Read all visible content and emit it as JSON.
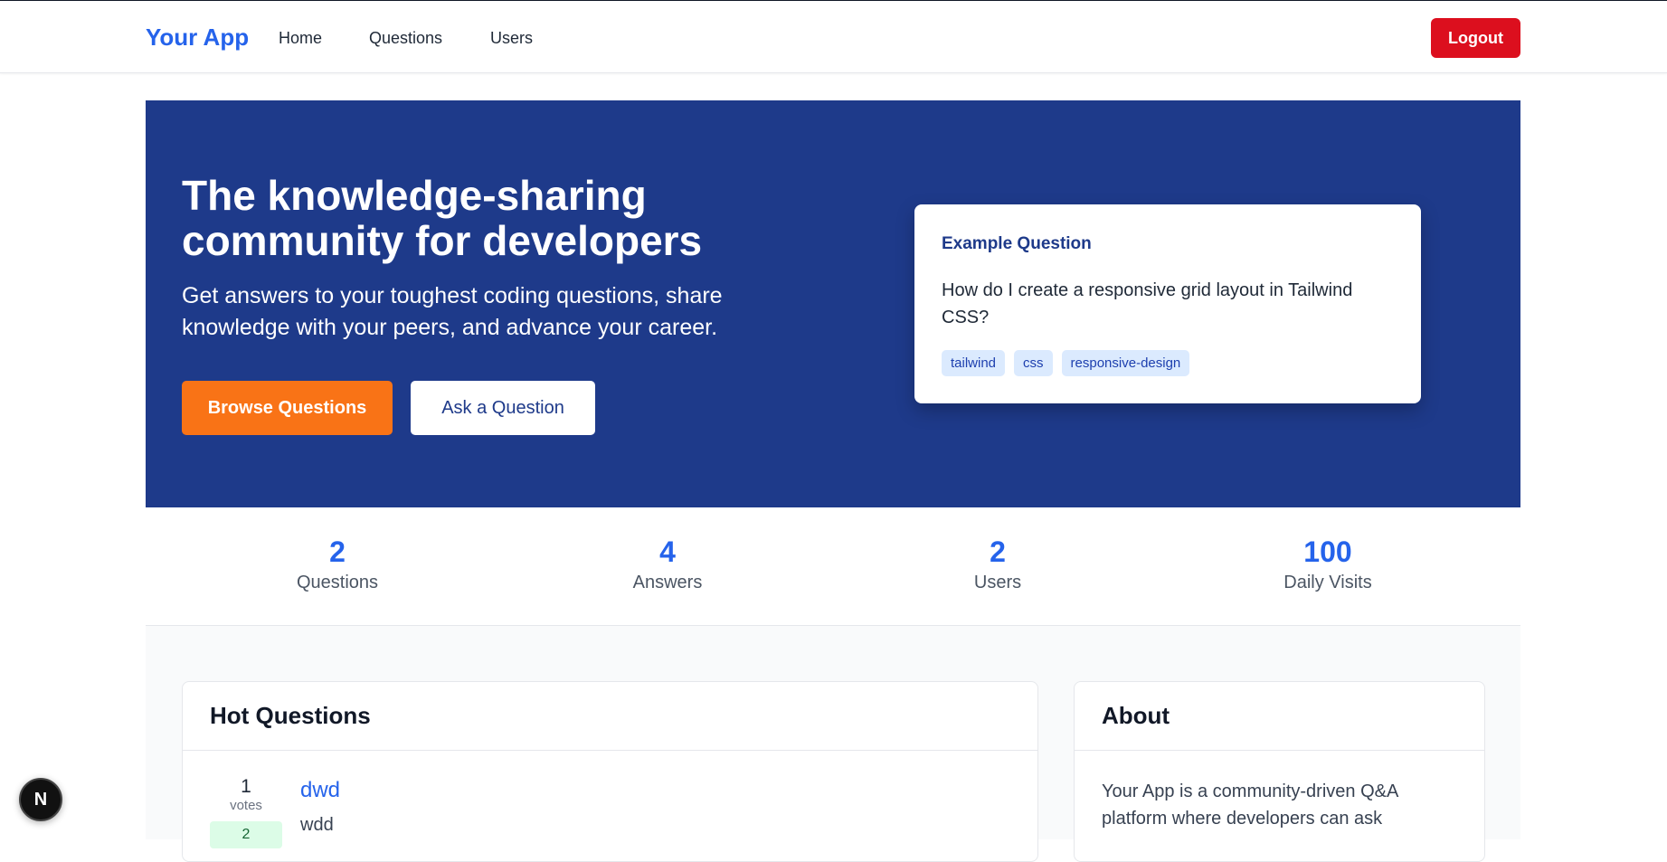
{
  "navbar": {
    "brand": "Your App",
    "links": [
      "Home",
      "Questions",
      "Users"
    ],
    "logout_label": "Logout"
  },
  "hero": {
    "title": "The knowledge-sharing community for developers",
    "subtitle": "Get answers to your toughest coding questions, share knowledge with your peers, and advance your career.",
    "browse_label": "Browse Questions",
    "ask_label": "Ask a Question",
    "example": {
      "label": "Example Question",
      "question": "How do I create a responsive grid layout in Tailwind CSS?",
      "tags": [
        "tailwind",
        "css",
        "responsive-design"
      ]
    }
  },
  "stats": [
    {
      "value": "2",
      "label": "Questions"
    },
    {
      "value": "4",
      "label": "Answers"
    },
    {
      "value": "2",
      "label": "Users"
    },
    {
      "value": "100",
      "label": "Daily Visits"
    }
  ],
  "hot_questions": {
    "heading": "Hot Questions",
    "items": [
      {
        "votes": "1",
        "votes_label": "votes",
        "answers": "2",
        "title": "dwd",
        "excerpt": "wdd"
      }
    ]
  },
  "about": {
    "heading": "About",
    "text": "Your App is a community-driven Q&A platform where developers can ask"
  },
  "badge": {
    "letter": "N"
  },
  "colors": {
    "brand": "#2563eb",
    "hero_bg": "#1e3a8a",
    "logout": "#dc0f1e",
    "browse": "#f97316"
  }
}
